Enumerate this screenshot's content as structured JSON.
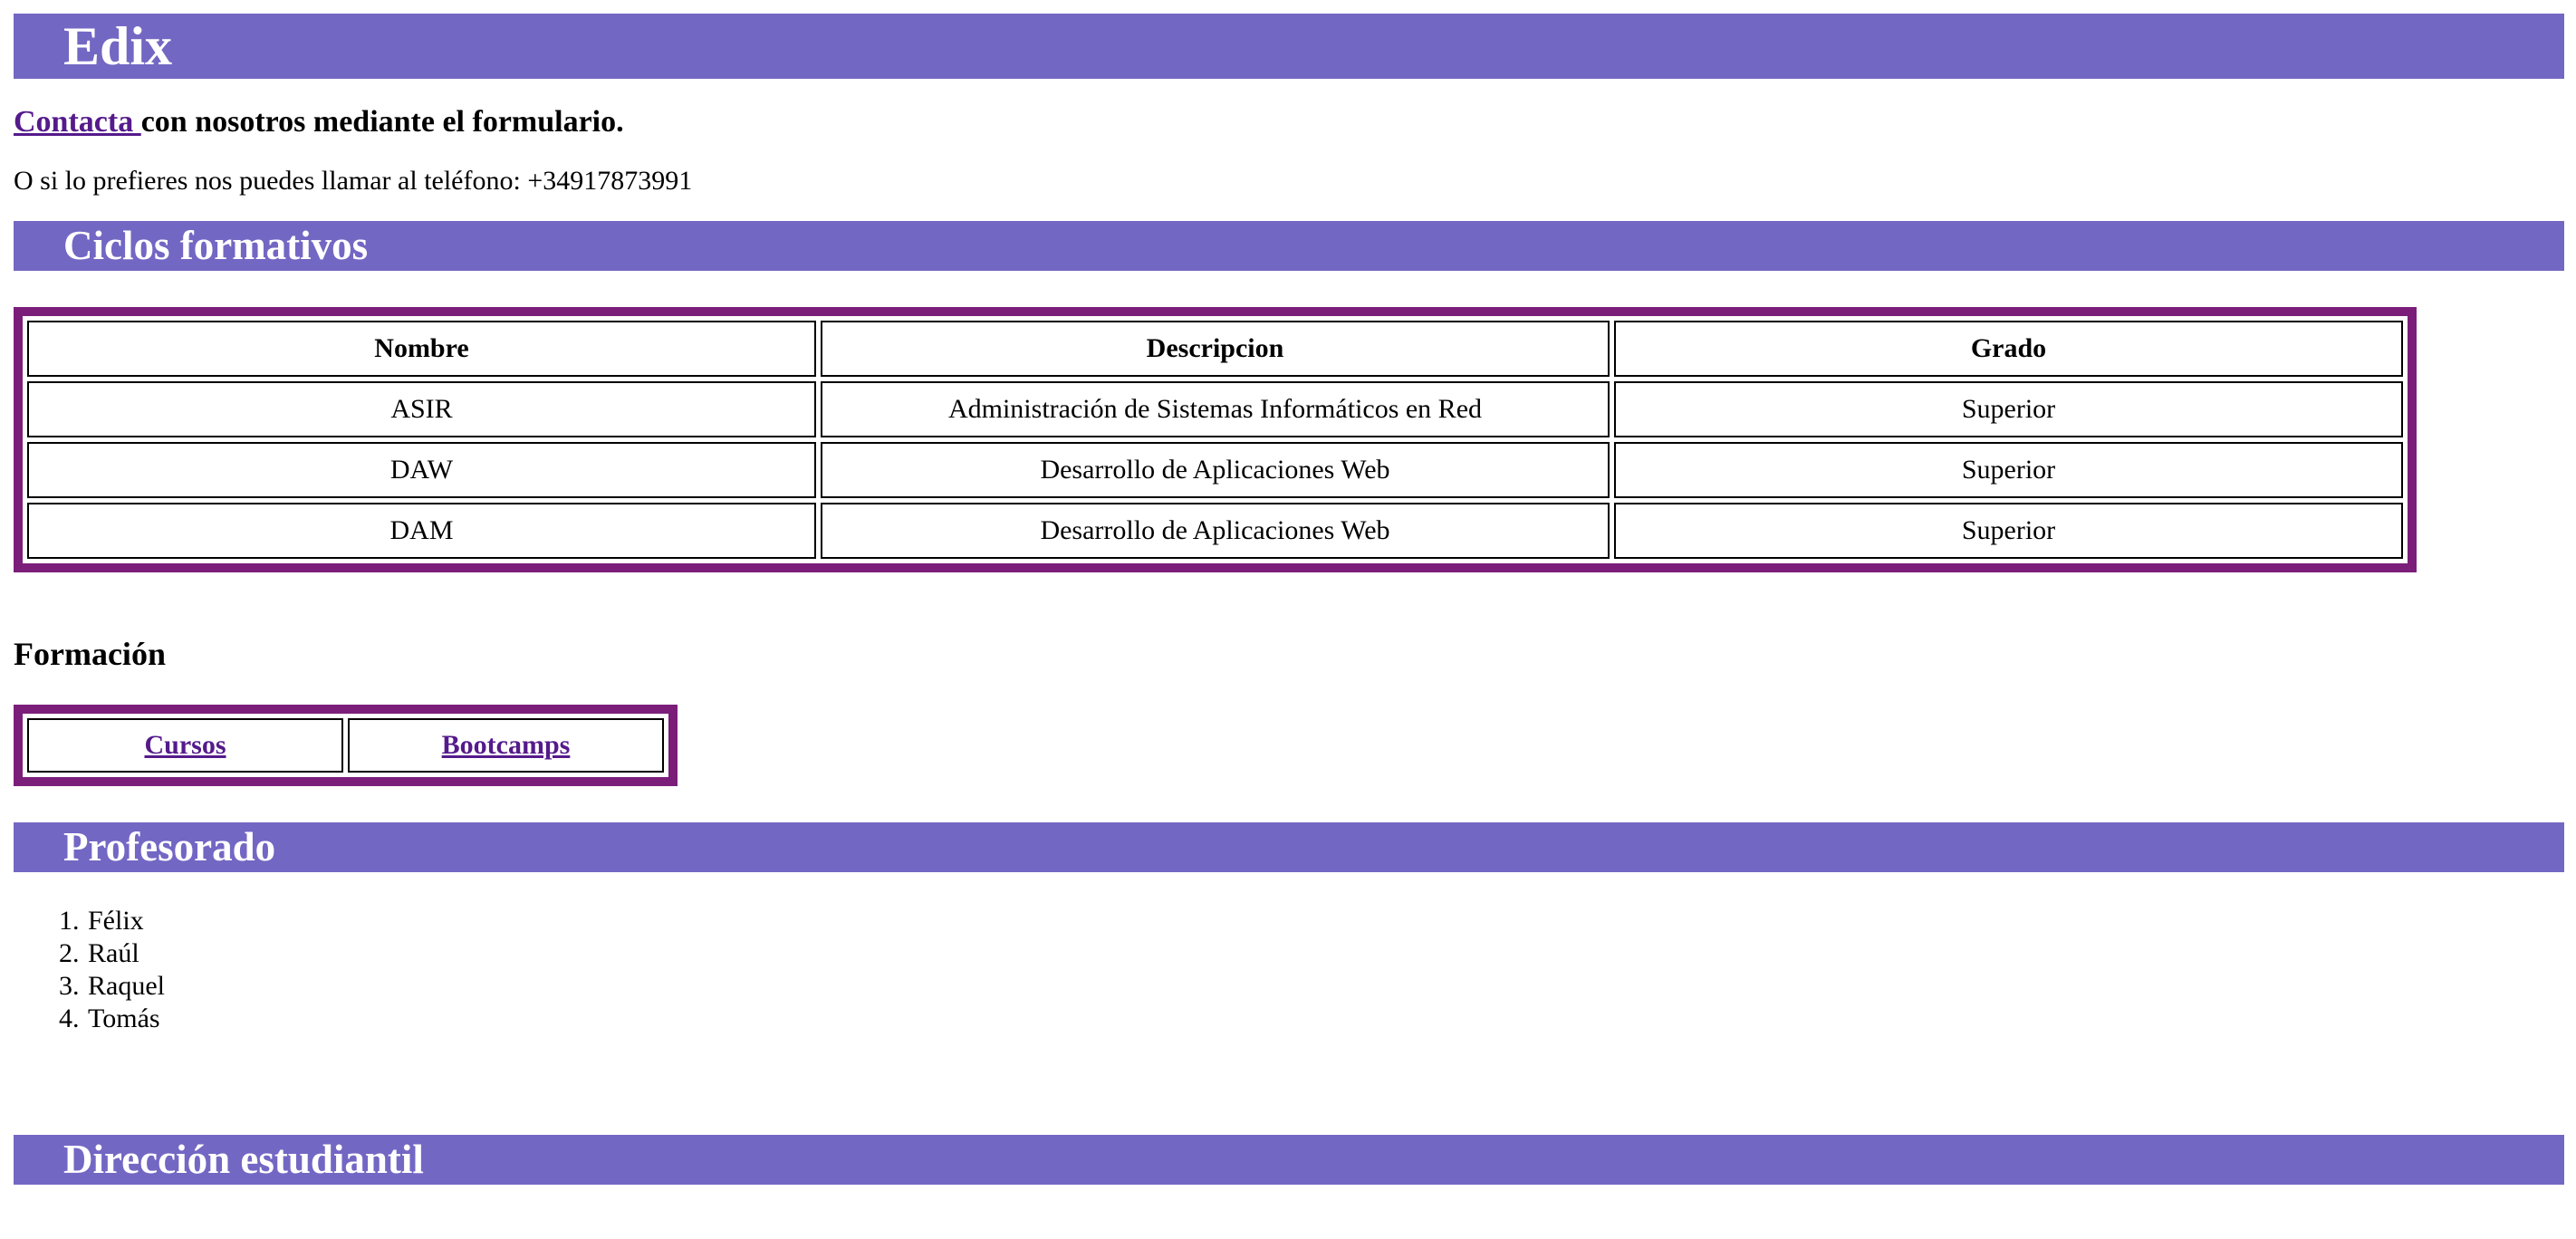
{
  "header": {
    "title": "Edix"
  },
  "contact": {
    "link_label": "Contacta ",
    "text": "con nosotros mediante el formulario.",
    "phone_text": "O si lo prefieres nos puedes llamar al teléfono: +34917873991"
  },
  "cycles": {
    "title": "Ciclos formativos",
    "columns": [
      "Nombre",
      "Descripcion",
      "Grado"
    ],
    "rows": [
      [
        "ASIR",
        "Administración de Sistemas Informáticos en Red",
        "Superior"
      ],
      [
        "DAW",
        "Desarrollo de Aplicaciones Web",
        "Superior"
      ],
      [
        "DAM",
        "Desarrollo de Aplicaciones Web",
        "Superior"
      ]
    ]
  },
  "training": {
    "title": "Formación",
    "links": [
      "Cursos",
      "Bootcamps"
    ]
  },
  "teachers": {
    "title": "Profesorado",
    "names": [
      "Félix",
      "Raúl",
      "Raquel",
      "Tomás"
    ]
  },
  "student_direction": {
    "title": "Dirección estudiantil"
  },
  "colors": {
    "banner_bg": "#7367c4",
    "table_border": "#7b1e7a",
    "link": "#551a8b"
  }
}
